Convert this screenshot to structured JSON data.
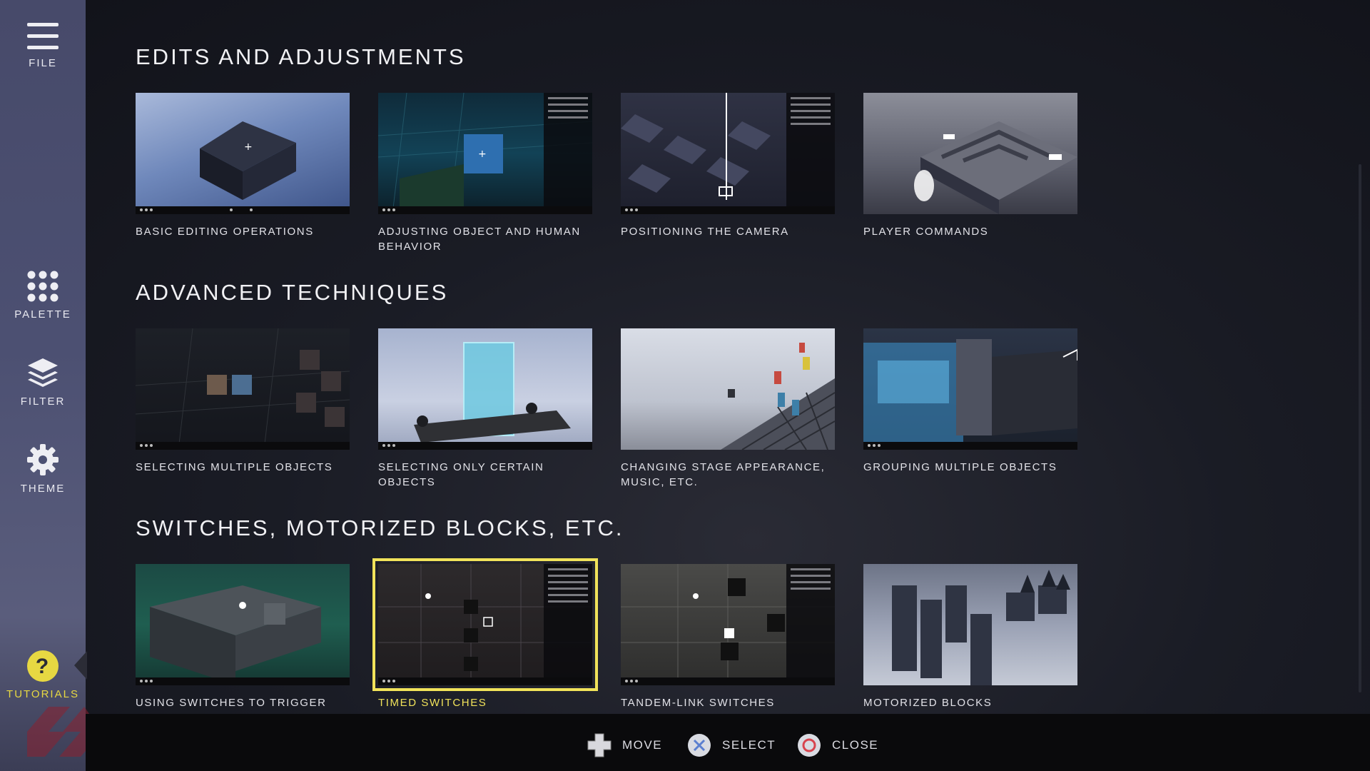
{
  "sidebar": {
    "items": [
      {
        "label": "FILE",
        "icon": "menu-icon"
      },
      {
        "label": "PALETTE",
        "icon": "palette-grid-icon"
      },
      {
        "label": "FILTER",
        "icon": "layers-icon"
      },
      {
        "label": "THEME",
        "icon": "gear-icon"
      },
      {
        "label": "TUTORIALS",
        "icon": "question-icon"
      }
    ],
    "active_color": "#e7d842"
  },
  "sections": [
    {
      "title": "EDITS AND ADJUSTMENTS",
      "cards": [
        {
          "caption": "BASIC EDITING OPERATIONS"
        },
        {
          "caption": "ADJUSTING OBJECT AND HUMAN BEHAVIOR"
        },
        {
          "caption": "POSITIONING THE CAMERA"
        },
        {
          "caption": "PLAYER COMMANDS"
        }
      ]
    },
    {
      "title": "ADVANCED TECHNIQUES",
      "cards": [
        {
          "caption": "SELECTING MULTIPLE OBJECTS"
        },
        {
          "caption": "SELECTING ONLY CERTAIN OBJECTS"
        },
        {
          "caption": "CHANGING STAGE APPEARANCE, MUSIC, ETC."
        },
        {
          "caption": "GROUPING MULTIPLE OBJECTS"
        }
      ]
    },
    {
      "title": "SWITCHES, MOTORIZED BLOCKS, ETC.",
      "cards": [
        {
          "caption": "USING SWITCHES TO TRIGGER"
        },
        {
          "caption": "TIMED SWITCHES",
          "selected": true
        },
        {
          "caption": "TANDEM-LINK SWITCHES"
        },
        {
          "caption": "MOTORIZED BLOCKS"
        }
      ]
    }
  ],
  "selection_color": "#f1e35a",
  "controls": [
    {
      "label": "MOVE",
      "icon": "dpad-icon"
    },
    {
      "label": "SELECT",
      "icon": "cross-button-icon"
    },
    {
      "label": "CLOSE",
      "icon": "circle-button-icon"
    }
  ]
}
